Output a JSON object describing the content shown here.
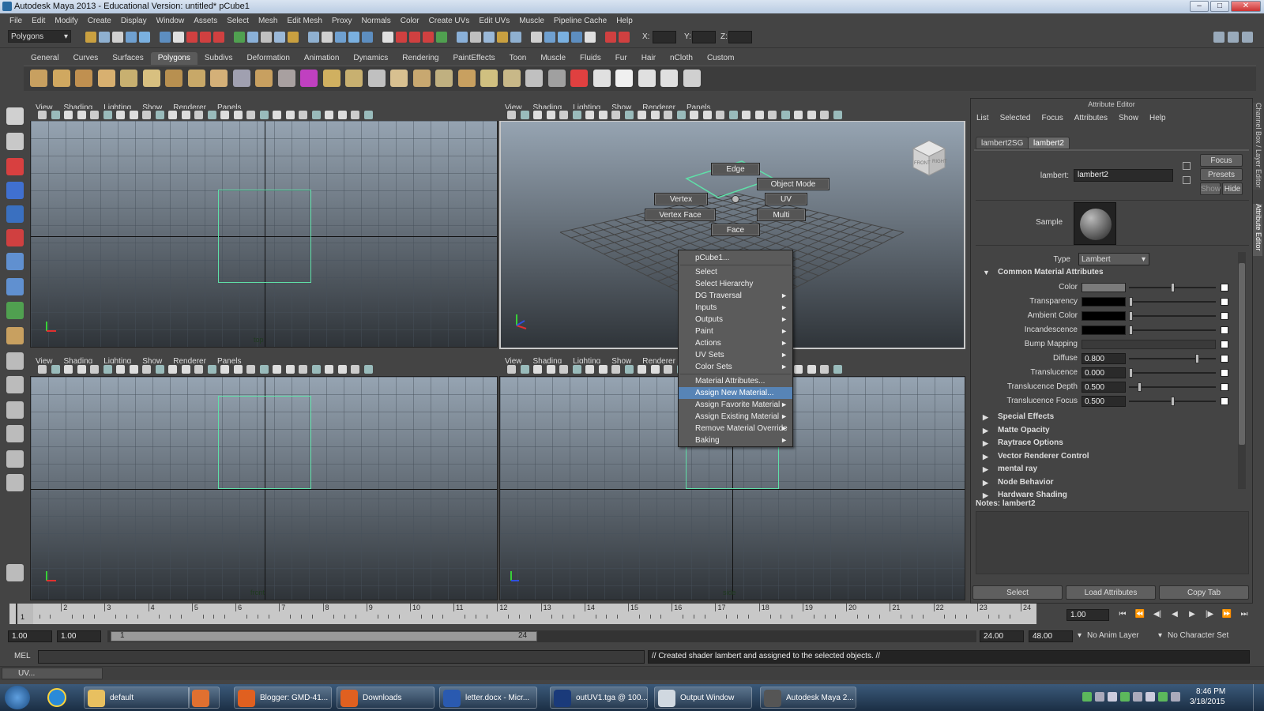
{
  "window": {
    "title": "Autodesk Maya 2013 - Educational Version: untitled*    pCube1",
    "min": "–",
    "max": "□",
    "close": "✕"
  },
  "menus": [
    "File",
    "Edit",
    "Modify",
    "Create",
    "Display",
    "Window",
    "Assets",
    "Select",
    "Mesh",
    "Edit Mesh",
    "Proxy",
    "Normals",
    "Color",
    "Create UVs",
    "Edit UVs",
    "Muscle",
    "Pipeline Cache",
    "Help"
  ],
  "status": {
    "mode": "Polygons",
    "x_label": "X:",
    "y_label": "Y:",
    "z_label": "Z:"
  },
  "shelf": {
    "tabs": [
      "General",
      "Curves",
      "Surfaces",
      "Polygons",
      "Subdivs",
      "Deformation",
      "Animation",
      "Dynamics",
      "Rendering",
      "PaintEffects",
      "Toon",
      "Muscle",
      "Fluids",
      "Fur",
      "Hair",
      "nCloth",
      "Custom"
    ],
    "active": "Polygons"
  },
  "viewport_menu": [
    "View",
    "Shading",
    "Lighting",
    "Show",
    "Renderer",
    "Panels"
  ],
  "viewports": {
    "top": "top",
    "front": "front",
    "side": "side"
  },
  "marking_menu": {
    "edge": "Edge",
    "object_mode": "Object Mode",
    "vertex": "Vertex",
    "uv": "UV",
    "vertex_face": "Vertex Face",
    "multi": "Multi",
    "face": "Face"
  },
  "view_cube": {
    "front": "FRONT",
    "right": "RIGHT"
  },
  "context_menu": {
    "items": [
      {
        "label": "pCube1...",
        "sub": ""
      },
      {
        "label": "Select",
        "sub": ""
      },
      {
        "label": "Select Hierarchy",
        "sub": ""
      },
      {
        "label": "DG Traversal",
        "sub": "►"
      },
      {
        "label": "Inputs",
        "sub": "►"
      },
      {
        "label": "Outputs",
        "sub": "►"
      },
      {
        "label": "Paint",
        "sub": "►"
      },
      {
        "label": "Actions",
        "sub": "►"
      },
      {
        "label": "UV Sets",
        "sub": "►"
      },
      {
        "label": "Color Sets",
        "sub": "►"
      },
      {
        "label": "Material Attributes...",
        "sub": ""
      },
      {
        "label": "Assign New Material...",
        "sub": ""
      },
      {
        "label": "Assign Favorite Material",
        "sub": "►"
      },
      {
        "label": "Assign Existing Material",
        "sub": "►"
      },
      {
        "label": "Remove Material Override",
        "sub": "►"
      },
      {
        "label": "Baking",
        "sub": "►"
      }
    ],
    "highlighted": "Assign New Material..."
  },
  "attribute_editor": {
    "title": "Attribute Editor",
    "menus": [
      "List",
      "Selected",
      "Focus",
      "Attributes",
      "Show",
      "Help"
    ],
    "tabs": [
      "lambert2SG",
      "lambert2"
    ],
    "node_label": "lambert:",
    "node_name": "lambert2",
    "buttons": {
      "focus": "Focus",
      "presets": "Presets",
      "show": "Show",
      "hide": "Hide"
    },
    "sample_label": "Sample",
    "type_label": "Type",
    "type_value": "Lambert",
    "common_section": "Common Material Attributes",
    "attributes": [
      {
        "label": "Color",
        "kind": "swatch",
        "color": "#7b7b7b",
        "slider": 0.5
      },
      {
        "label": "Transparency",
        "kind": "swatch",
        "color": "#000000",
        "slider": 0.0
      },
      {
        "label": "Ambient Color",
        "kind": "swatch",
        "color": "#000000",
        "slider": 0.0
      },
      {
        "label": "Incandescence",
        "kind": "swatch",
        "color": "#000000",
        "slider": 0.0
      },
      {
        "label": "Bump Mapping",
        "kind": "bump",
        "color": "",
        "slider": 0
      },
      {
        "label": "Diffuse",
        "kind": "value",
        "value": "0.800",
        "slider": 0.8
      },
      {
        "label": "Translucence",
        "kind": "value",
        "value": "0.000",
        "slider": 0.0
      },
      {
        "label": "Translucence Depth",
        "kind": "value",
        "value": "0.500",
        "slider": 0.1
      },
      {
        "label": "Translucence Focus",
        "kind": "value",
        "value": "0.500",
        "slider": 0.5
      }
    ],
    "sections": [
      "Special Effects",
      "Matte Opacity",
      "Raytrace Options",
      "Vector Renderer Control",
      "mental ray",
      "Node Behavior",
      "Hardware Shading"
    ],
    "notes": "Notes:  lambert2",
    "bottom_buttons": {
      "select": "Select",
      "load": "Load Attributes",
      "copy": "Copy Tab"
    }
  },
  "side_tabs": {
    "channel": "Channel Box / Layer Editor",
    "attribute": "Attribute Editor"
  },
  "timeline": {
    "start": 1,
    "end": 24,
    "current": 1,
    "current_frame": "1.00"
  },
  "range": {
    "start_time": "1.00",
    "start_range": "1.00",
    "range_start": "1",
    "range_end": "24",
    "end_range": "24.00",
    "end_time": "48.00",
    "anim_layer": "No Anim Layer",
    "char_set": "No Character Set"
  },
  "cmd": {
    "label": "MEL",
    "result": "// Created shader lambert and assigned to the selected objects. //"
  },
  "help": {
    "tab": "UV..."
  },
  "taskbar": {
    "items": [
      {
        "label": "default",
        "color": "#e8c060"
      },
      {
        "label": "",
        "color": "#e07030"
      },
      {
        "label": "Blogger: GMD-41...",
        "color": "#e06020"
      },
      {
        "label": "Downloads",
        "color": "#e06020"
      },
      {
        "label": "letter.docx - Micr...",
        "color": "#2a5ab0"
      },
      {
        "label": "outUV1.tga @ 100...",
        "color": "#1a3a7a"
      },
      {
        "label": "Output Window",
        "color": "#d0d8e0"
      },
      {
        "label": "Autodesk Maya 2...",
        "color": "#555"
      }
    ],
    "time": "8:46 PM",
    "date": "3/18/2015"
  }
}
